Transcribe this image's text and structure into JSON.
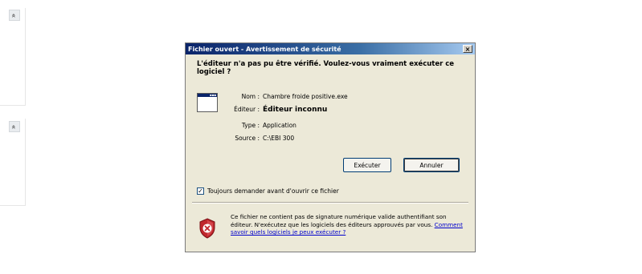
{
  "page": {
    "collapse_glyph": "»"
  },
  "dialog": {
    "title": "Fichier ouvert - Avertissement de sécurité",
    "close_glyph": "×",
    "heading": "L'éditeur n'a pas pu être vérifié. Voulez-vous vraiment exécuter ce logiciel ?",
    "fields": [
      {
        "label": "Nom :",
        "value": "Chambre froide positive.exe",
        "bold": false
      },
      {
        "label": "Éditeur :",
        "value": "Éditeur inconnu",
        "bold": true
      },
      {
        "label": "Type :",
        "value": "Application",
        "bold": false
      },
      {
        "label": "Source :",
        "value": "C:\\EBI 300",
        "bold": false
      }
    ],
    "run_button": "Exécuter",
    "cancel_button": "Annuler",
    "always_ask": {
      "label": "Toujours demander avant d'ouvrir ce fichier",
      "checked": true,
      "check_glyph": "✓"
    },
    "warning": {
      "text": "Ce fichier ne contient pas de signature numérique valide authentifiant son éditeur. N'exécutez que les logiciels des éditeurs approuvés par vous.",
      "link": "Comment savoir quels logiciels je peux exécuter ?"
    }
  },
  "icons": {
    "app": "application-window-icon",
    "shield": "security-shield-icon"
  },
  "colors": {
    "title_bar_start": "#0a246a",
    "title_bar_end": "#a6caf0",
    "dialog_bg": "#ece9d8",
    "shield_red": "#c0272d",
    "link": "#0000cc"
  }
}
